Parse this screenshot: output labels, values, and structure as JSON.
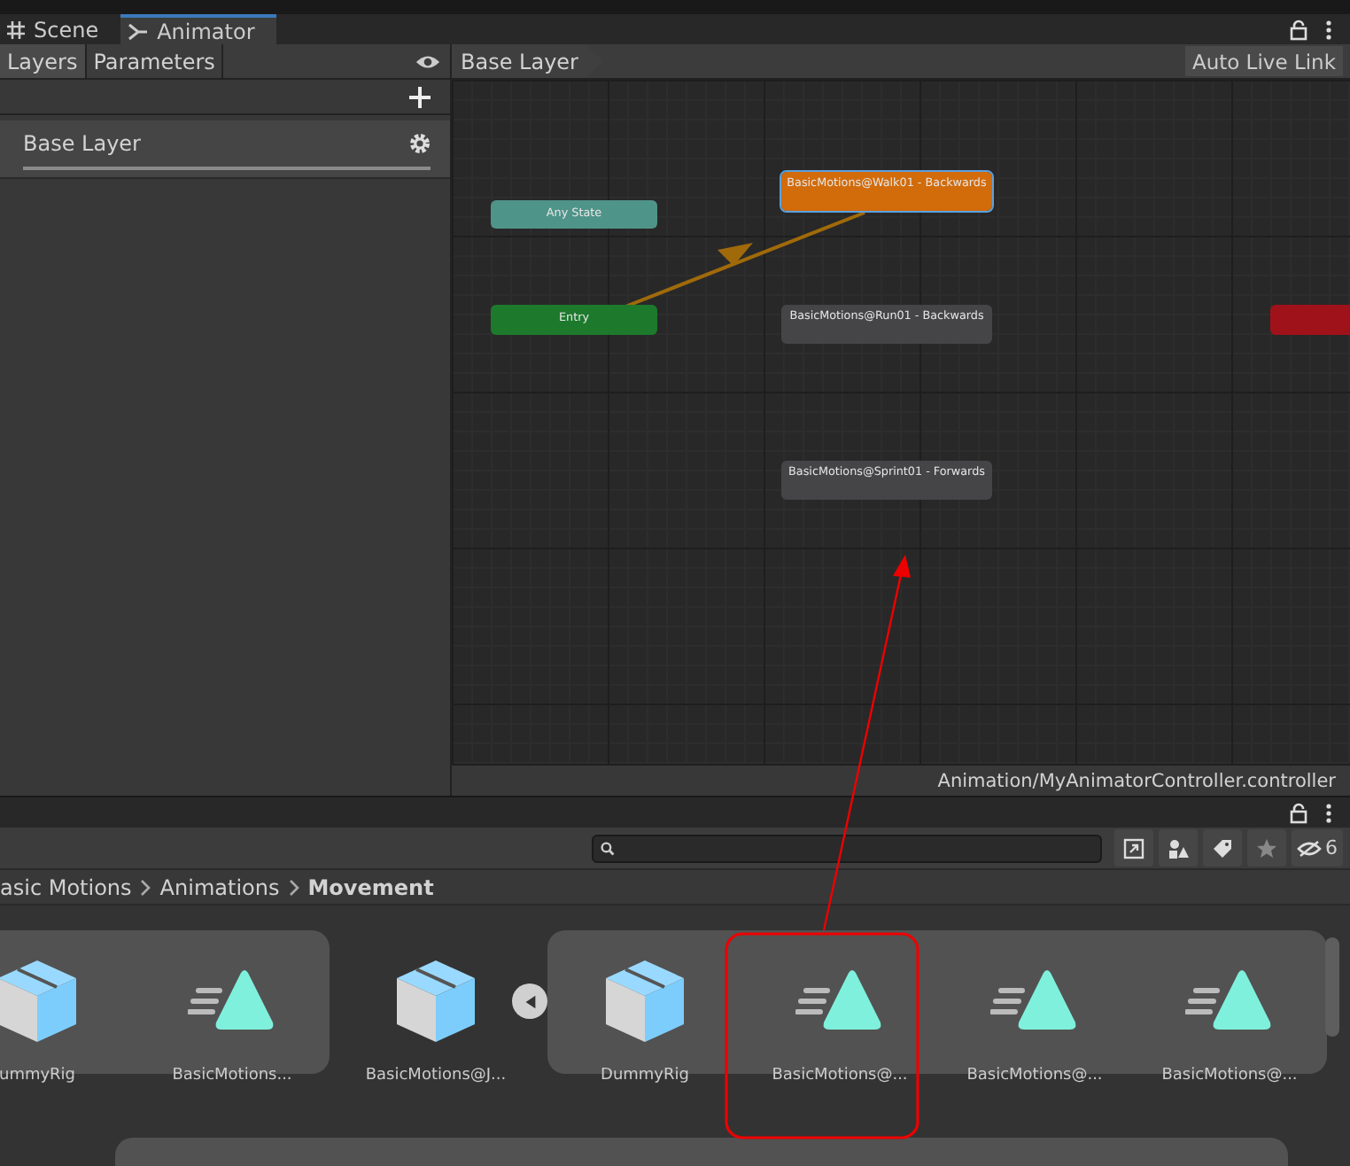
{
  "editor_tabs": [
    {
      "label": "Scene",
      "kind": "scene",
      "selected": false
    },
    {
      "label": "Animator",
      "kind": "animator",
      "selected": true
    }
  ],
  "animator": {
    "panel_tabs": [
      {
        "label": "Layers",
        "selected": true
      },
      {
        "label": "Parameters",
        "selected": false
      }
    ],
    "layers": [
      {
        "name": "Base Layer"
      }
    ],
    "breadcrumb": [
      "Base Layer"
    ],
    "auto_live_link": "Auto Live Link",
    "states": [
      {
        "label": "Any State",
        "kind": "any"
      },
      {
        "label": "Entry",
        "kind": "entry"
      },
      {
        "label": "BasicMotions@Walk01 - Backwards",
        "kind": "default"
      },
      {
        "label": "BasicMotions@Run01 - Backwards",
        "kind": "state"
      },
      {
        "label": "BasicMotions@Sprint01 - Forwards",
        "kind": "state"
      },
      {
        "kind": "exit"
      }
    ],
    "status_path": "Animation/MyAnimatorController.controller"
  },
  "project": {
    "hidden_count": "6",
    "breadcrumb": [
      "asic Motions",
      "Animations",
      "Movement"
    ],
    "assets": [
      {
        "kind": "group",
        "items": [
          {
            "label": "ummyRig",
            "kind": "model"
          },
          {
            "label": "BasicMotions...",
            "kind": "clip"
          }
        ]
      },
      {
        "kind": "expandable",
        "expanded": true,
        "items": [
          {
            "label": "BasicMotions@J...",
            "kind": "model"
          }
        ]
      },
      {
        "kind": "group",
        "items": [
          {
            "label": "DummyRig",
            "kind": "model"
          },
          {
            "label": "BasicMotions@...",
            "kind": "clip"
          },
          {
            "label": "BasicMotions@...",
            "kind": "clip"
          },
          {
            "label": "BasicMotions@...",
            "kind": "clip"
          }
        ]
      }
    ]
  }
}
